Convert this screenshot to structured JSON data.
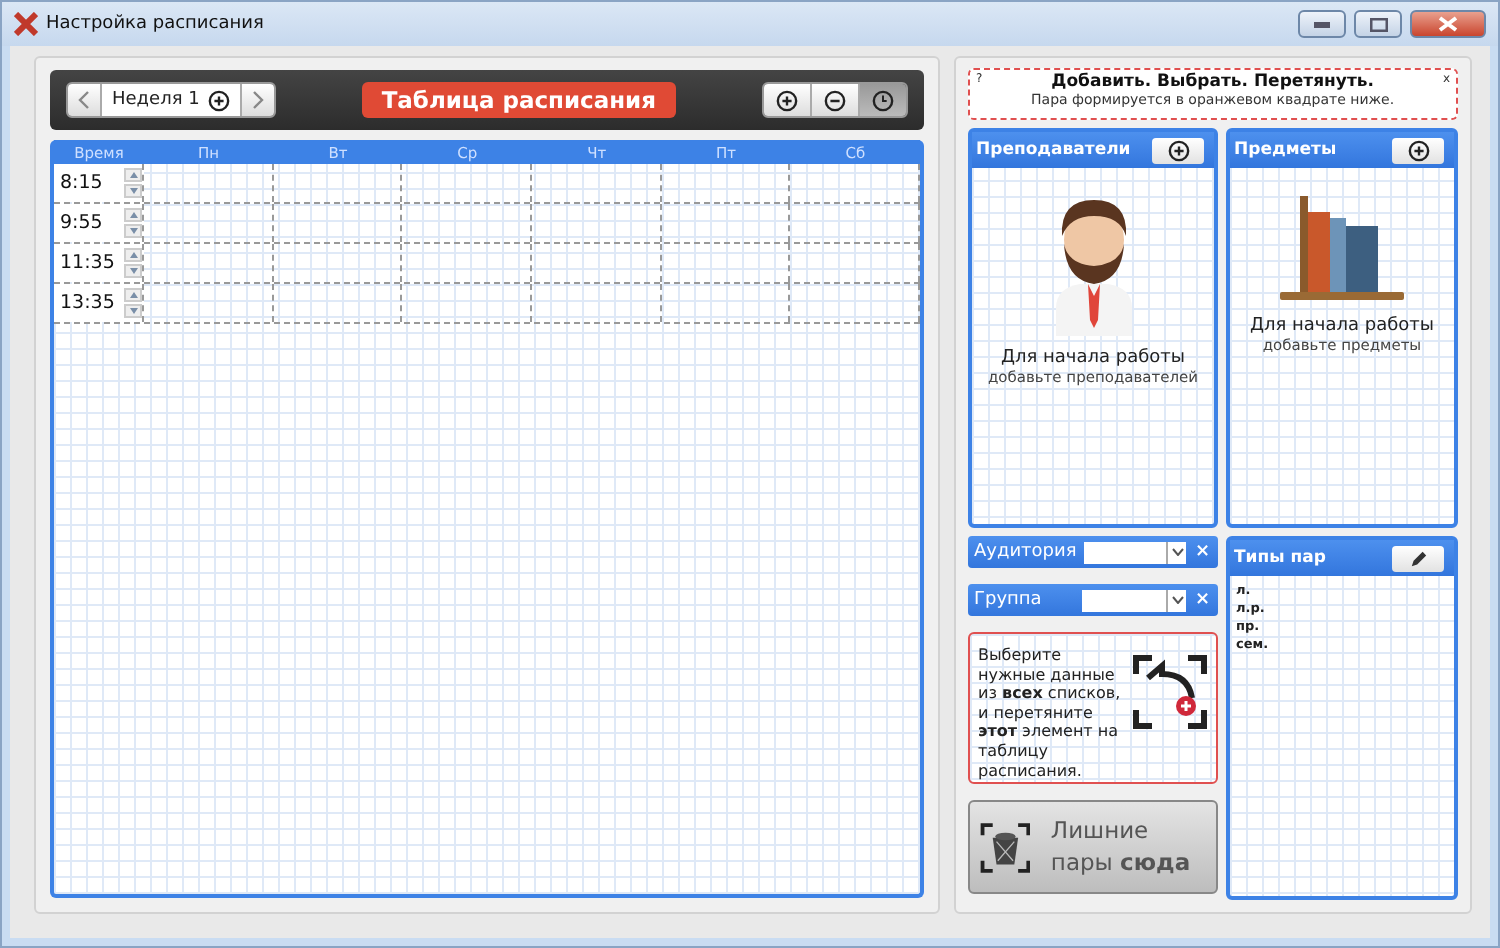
{
  "window": {
    "title": "Настройка расписания"
  },
  "toolbar": {
    "week": "Неделя 1",
    "title": "Таблица расписания",
    "view_buttons": [
      {
        "kind": "plus",
        "selected": false
      },
      {
        "kind": "minus",
        "selected": false
      },
      {
        "kind": "clock",
        "selected": true
      }
    ]
  },
  "schedule": {
    "columns": [
      "Время",
      "Пн",
      "Вт",
      "Ср",
      "Чт",
      "Пт",
      "Сб"
    ],
    "rows": [
      {
        "time": "8:15"
      },
      {
        "time": "9:55"
      },
      {
        "time": "11:35"
      },
      {
        "time": "13:35"
      }
    ]
  },
  "hint": {
    "help": "?",
    "title": "Добавить. Выбрать. Перетянуть.",
    "subtitle": "Пара формируется в оранжевом квадрате ниже.",
    "close": "x"
  },
  "panels": [
    {
      "kind": "person",
      "title": "Преподаватели",
      "empty_title": "Для начала работы",
      "empty_hint": "добавьте преподавателей"
    },
    {
      "kind": "books",
      "title": "Предметы",
      "empty_title": "Для начала работы",
      "empty_hint": "добавьте предметы"
    }
  ],
  "filters": [
    {
      "label": "Аудитория",
      "clear": "×"
    },
    {
      "label": "Группа",
      "clear": "×"
    }
  ],
  "instruction": "Выберите нужные данные из **всех** списков, и перетяните **этот** элемент на таблицу расписания.",
  "trash": "Лишние пары **сюда**",
  "lesson_types": {
    "title": "Типы пар",
    "items": [
      "л.",
      "л.р.",
      "пр.",
      "сем."
    ]
  }
}
